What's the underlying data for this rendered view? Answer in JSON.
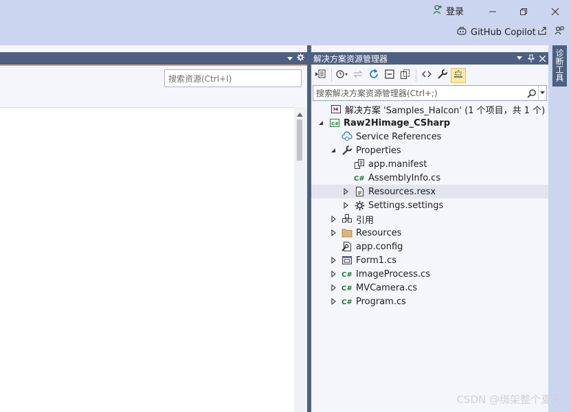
{
  "titlebar": {
    "signin_label": "登录",
    "copilot_label": "GitHub Copilot"
  },
  "left_panel": {
    "search_placeholder": "搜索资源(Ctrl+I)"
  },
  "solution_explorer": {
    "title": "解决方案资源管理器",
    "search_placeholder": "搜索解决方案资源管理器(Ctrl+;)",
    "tree": [
      {
        "label": "解决方案 'Samples_Halcon' (1 个项目，共 1 个)",
        "icon": "solution-icon",
        "expander": "none"
      },
      {
        "label": "Raw2Himage_CSharp",
        "icon": "csharp-project-icon",
        "expander": "expanded",
        "bold": true
      },
      {
        "label": "Service References",
        "icon": "service-references-icon",
        "expander": "none"
      },
      {
        "label": "Properties",
        "icon": "wrench-icon",
        "expander": "expanded"
      },
      {
        "label": "app.manifest",
        "icon": "manifest-icon",
        "expander": "none"
      },
      {
        "label": "AssemblyInfo.cs",
        "icon": "csharp-file-icon",
        "expander": "none"
      },
      {
        "label": "Resources.resx",
        "icon": "resx-icon",
        "expander": "collapsed",
        "highlighted": true
      },
      {
        "label": "Settings.settings",
        "icon": "gear-icon",
        "expander": "collapsed"
      },
      {
        "label": "引用",
        "icon": "references-icon",
        "expander": "collapsed"
      },
      {
        "label": "Resources",
        "icon": "folder-icon",
        "expander": "collapsed"
      },
      {
        "label": "app.config",
        "icon": "config-icon",
        "expander": "none"
      },
      {
        "label": "Form1.cs",
        "icon": "form-icon",
        "expander": "collapsed"
      },
      {
        "label": "ImageProcess.cs",
        "icon": "csharp-file-icon",
        "expander": "collapsed"
      },
      {
        "label": "MVCamera.cs",
        "icon": "csharp-file-icon",
        "expander": "collapsed"
      },
      {
        "label": "Program.cs",
        "icon": "csharp-file-icon",
        "expander": "collapsed"
      }
    ]
  },
  "side_tab": {
    "label": "诊断工具"
  },
  "watermark": "CSDN @绑架整个夏天",
  "colors": {
    "titlebar_bg": "#ccd5f0",
    "panel_header": "#4d6082",
    "accent_orange": "#e8a25a",
    "csharp_green": "#1f7a33",
    "active_button": "#fde8a6"
  }
}
